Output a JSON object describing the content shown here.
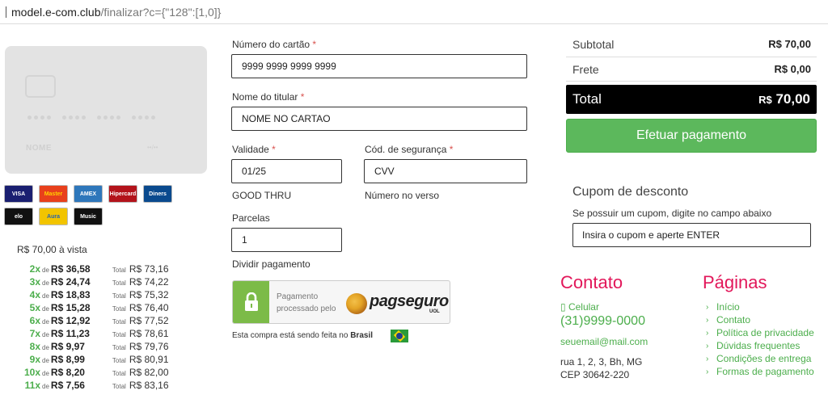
{
  "browser": {
    "url_host": "model.e-com.club",
    "url_path": "/finalizar?c={\"128\":[1,0]}"
  },
  "card_preview": {
    "name_placeholder": "NOME",
    "expiry_placeholder": "••/••"
  },
  "brands": [
    {
      "name": "VISA",
      "bg": "#1a1f71",
      "fg": "#ffffff"
    },
    {
      "name": "Master",
      "bg": "#e8401c",
      "fg": "#ffd000"
    },
    {
      "name": "AMEX",
      "bg": "#2e77bb",
      "fg": "#ffffff"
    },
    {
      "name": "Hipercard",
      "bg": "#b3131b",
      "fg": "#ffffff"
    },
    {
      "name": "Diners",
      "bg": "#0a4a8e",
      "fg": "#ffffff"
    },
    {
      "name": "elo",
      "bg": "#111111",
      "fg": "#ffffff"
    },
    {
      "name": "Aura",
      "bg": "#f2c400",
      "fg": "#2a64ad"
    },
    {
      "name": "Music",
      "bg": "#111111",
      "fg": "#ffffff"
    }
  ],
  "payment": {
    "a_vista": "R$ 70,00 à vista",
    "de": "de",
    "total_label": "Total",
    "installments": [
      {
        "n": "2x",
        "value": "R$ 36,58",
        "total": "R$ 73,16"
      },
      {
        "n": "3x",
        "value": "R$ 24,74",
        "total": "R$ 74,22"
      },
      {
        "n": "4x",
        "value": "R$ 18,83",
        "total": "R$ 75,32"
      },
      {
        "n": "5x",
        "value": "R$ 15,28",
        "total": "R$ 76,40"
      },
      {
        "n": "6x",
        "value": "R$ 12,92",
        "total": "R$ 77,52"
      },
      {
        "n": "7x",
        "value": "R$ 11,23",
        "total": "R$ 78,61"
      },
      {
        "n": "8x",
        "value": "R$ 9,97",
        "total": "R$ 79,76"
      },
      {
        "n": "9x",
        "value": "R$ 8,99",
        "total": "R$ 80,91"
      },
      {
        "n": "10x",
        "value": "R$ 8,20",
        "total": "R$ 82,00"
      },
      {
        "n": "11x",
        "value": "R$ 7,56",
        "total": "R$ 83,16"
      }
    ]
  },
  "form": {
    "card_number_label": "Número do cartão",
    "card_number_value": "9999 9999 9999 9999",
    "holder_label": "Nome do titular",
    "holder_value": "NOME NO CARTAO",
    "validity_label": "Validade",
    "validity_value": "01/25",
    "validity_hint": "GOOD THRU",
    "cvv_label": "Cód. de segurança",
    "cvv_value": "CVV",
    "cvv_hint": "Número no verso",
    "parcelas_label": "Parcelas",
    "parcelas_value": "1",
    "dividir_label": "Dividir pagamento",
    "required_mark": "*"
  },
  "pagseguro": {
    "text": "Pagamento processado pelo",
    "brand": "pagseguro",
    "sub": "UOL"
  },
  "country_note": {
    "text": "Esta compra está sendo feita no",
    "country": "Brasil"
  },
  "summary": {
    "subtotal_label": "Subtotal",
    "subtotal_value": "R$ 70,00",
    "frete_label": "Frete",
    "frete_value": "R$ 0,00",
    "total_label": "Total",
    "total_currency": "R$",
    "total_value": "70,00",
    "pay_button": "Efetuar pagamento"
  },
  "cupom": {
    "title": "Cupom de desconto",
    "description": "Se possuir um cupom, digite no campo abaixo",
    "placeholder": "Insira o cupom e aperte ENTER"
  },
  "footer": {
    "contato_title": "Contato",
    "celular_label": "Celular",
    "phone": "(31)9999-0000",
    "email": "seuemail@mail.com",
    "address_line1": "rua 1, 2, 3, Bh, MG",
    "address_line2": "CEP 30642-220",
    "paginas_title": "Páginas",
    "pages": [
      "Início",
      "Contato",
      "Política de privacidade",
      "Dúvidas frequentes",
      "Condições de entrega",
      "Formas de pagamento"
    ]
  },
  "colors": {
    "accent_green": "#4cae4c",
    "button_green": "#5cb85c",
    "footer_title": "#e2175a",
    "required": "#d9534f"
  }
}
